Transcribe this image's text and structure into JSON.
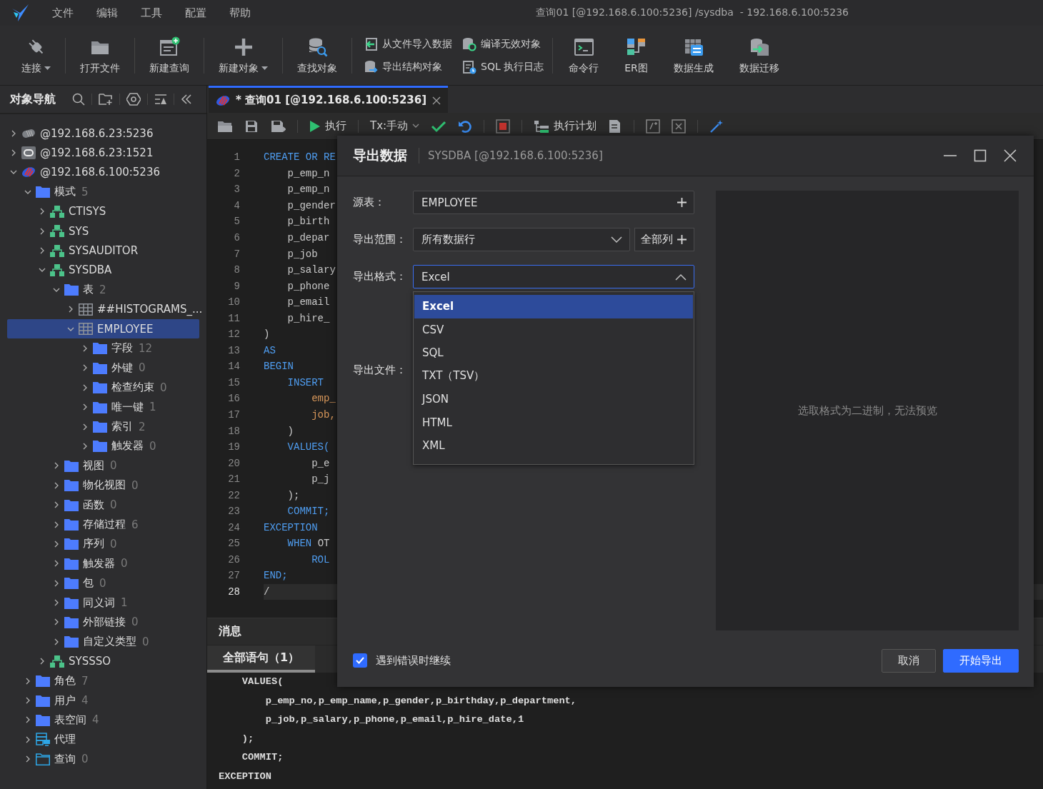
{
  "menu": {
    "items": [
      "文件",
      "编辑",
      "工具",
      "配置",
      "帮助"
    ],
    "title": "查询01 [@192.168.6.100:5236] /sysdba  - 192.168.6.100:5236"
  },
  "toolbar": [
    {
      "kind": "large",
      "label": "连接",
      "dropdown": true
    },
    {
      "kind": "separator"
    },
    {
      "kind": "large",
      "label": "打开文件",
      "dropdown": false
    },
    {
      "kind": "separator"
    },
    {
      "kind": "large",
      "label": "新建查询",
      "dropdown": false
    },
    {
      "kind": "separator"
    },
    {
      "kind": "large",
      "label": "新建对象",
      "dropdown": true
    },
    {
      "kind": "separator"
    },
    {
      "kind": "large",
      "label": "查找对象",
      "dropdown": false
    },
    {
      "kind": "separator"
    },
    {
      "kind": "pairs",
      "columns": [
        [
          "从文件导入数据",
          "导出结构对象"
        ],
        [
          "编译无效对象",
          "SQL 执行日志"
        ]
      ]
    },
    {
      "kind": "separator"
    },
    {
      "kind": "large",
      "label": "命令行",
      "dropdown": false
    },
    {
      "kind": "large",
      "label": "ER图",
      "dropdown": false
    },
    {
      "kind": "large",
      "label": "数据生成",
      "dropdown": false
    },
    {
      "kind": "large",
      "label": "数据迁移",
      "dropdown": false
    }
  ],
  "sidebar": {
    "title": "对象导航",
    "tree": [
      {
        "label": "@192.168.6.23:5236",
        "kind": "server",
        "expanded": false,
        "selected": false
      },
      {
        "label": "@192.168.6.23:1521",
        "kind": "oracle",
        "expanded": false,
        "selected": false
      },
      {
        "label": "@192.168.6.100:5236",
        "kind": "dm",
        "expanded": true,
        "selected": false,
        "children": [
          {
            "label": "模式",
            "count": "5",
            "kind": "folder",
            "expanded": true,
            "selected": false,
            "children": [
              {
                "label": "CTISYS",
                "kind": "schema",
                "expanded": false,
                "selected": false
              },
              {
                "label": "SYS",
                "kind": "schema",
                "expanded": false,
                "selected": false
              },
              {
                "label": "SYSAUDITOR",
                "kind": "schema",
                "expanded": false,
                "selected": false
              },
              {
                "label": "SYSDBA",
                "kind": "schema",
                "expanded": true,
                "selected": false,
                "children": [
                  {
                    "label": "表",
                    "count": "2",
                    "kind": "folder",
                    "expanded": true,
                    "selected": false,
                    "children": [
                      {
                        "label": "##HISTOGRAMS_...",
                        "kind": "table",
                        "expanded": false,
                        "selected": false
                      },
                      {
                        "label": "EMPLOYEE",
                        "kind": "table",
                        "expanded": true,
                        "selected": true,
                        "children": [
                          {
                            "label": "字段",
                            "count": "12",
                            "kind": "folder",
                            "expanded": false,
                            "selected": false
                          },
                          {
                            "label": "外键",
                            "count": "0",
                            "kind": "folder",
                            "expanded": false,
                            "selected": false
                          },
                          {
                            "label": "检查约束",
                            "count": "0",
                            "kind": "folder",
                            "expanded": false,
                            "selected": false
                          },
                          {
                            "label": "唯一键",
                            "count": "1",
                            "kind": "folder",
                            "expanded": false,
                            "selected": false
                          },
                          {
                            "label": "索引",
                            "count": "2",
                            "kind": "folder",
                            "expanded": false,
                            "selected": false
                          },
                          {
                            "label": "触发器",
                            "count": "0",
                            "kind": "folder",
                            "expanded": false,
                            "selected": false
                          }
                        ]
                      }
                    ]
                  },
                  {
                    "label": "视图",
                    "count": "0",
                    "kind": "folder",
                    "expanded": false,
                    "selected": false
                  },
                  {
                    "label": "物化视图",
                    "count": "0",
                    "kind": "folder",
                    "expanded": false,
                    "selected": false
                  },
                  {
                    "label": "函数",
                    "count": "0",
                    "kind": "folder",
                    "expanded": false,
                    "selected": false
                  },
                  {
                    "label": "存储过程",
                    "count": "6",
                    "kind": "folder",
                    "expanded": false,
                    "selected": false
                  },
                  {
                    "label": "序列",
                    "count": "0",
                    "kind": "folder",
                    "expanded": false,
                    "selected": false
                  },
                  {
                    "label": "触发器",
                    "count": "0",
                    "kind": "folder",
                    "expanded": false,
                    "selected": false
                  },
                  {
                    "label": "包",
                    "count": "0",
                    "kind": "folder",
                    "expanded": false,
                    "selected": false
                  },
                  {
                    "label": "同义词",
                    "count": "1",
                    "kind": "folder",
                    "expanded": false,
                    "selected": false
                  },
                  {
                    "label": "外部链接",
                    "count": "0",
                    "kind": "folder",
                    "expanded": false,
                    "selected": false
                  },
                  {
                    "label": "自定义类型",
                    "count": "0",
                    "kind": "folder",
                    "expanded": false,
                    "selected": false
                  }
                ]
              },
              {
                "label": "SYSSSO",
                "kind": "schema",
                "expanded": false,
                "selected": false
              }
            ]
          },
          {
            "label": "角色",
            "count": "7",
            "kind": "folder",
            "expanded": false,
            "selected": false
          },
          {
            "label": "用户",
            "count": "4",
            "kind": "folder",
            "expanded": false,
            "selected": false
          },
          {
            "label": "表空间",
            "count": "4",
            "kind": "folder",
            "expanded": false,
            "selected": false
          },
          {
            "label": "代理",
            "kind": "agent",
            "expanded": false,
            "selected": false
          },
          {
            "label": "查询",
            "count": "0",
            "kind": "query",
            "expanded": false,
            "selected": false
          }
        ]
      }
    ]
  },
  "editor": {
    "tab": {
      "label": "* 查询01 [@192.168.6.100:5236]",
      "selected": true
    },
    "run_label": "执行",
    "tx_label": "Tx:手动",
    "plan_label": "执行计划",
    "lines": [
      {
        "number": "1",
        "current": false,
        "segments": [
          {
            "text": "CREATE OR RE",
            "kind": "keyword"
          }
        ]
      },
      {
        "number": "2",
        "current": false,
        "segments": [
          {
            "text": "    p_emp_n",
            "kind": "plain"
          }
        ]
      },
      {
        "number": "3",
        "current": false,
        "segments": [
          {
            "text": "    p_emp_n",
            "kind": "plain"
          }
        ]
      },
      {
        "number": "4",
        "current": false,
        "segments": [
          {
            "text": "    p_gender",
            "kind": "plain"
          }
        ]
      },
      {
        "number": "5",
        "current": false,
        "segments": [
          {
            "text": "    p_birth",
            "kind": "plain"
          }
        ]
      },
      {
        "number": "6",
        "current": false,
        "segments": [
          {
            "text": "    p_depar",
            "kind": "plain"
          }
        ]
      },
      {
        "number": "7",
        "current": false,
        "segments": [
          {
            "text": "    p_job",
            "kind": "plain"
          }
        ]
      },
      {
        "number": "8",
        "current": false,
        "segments": [
          {
            "text": "    p_salary",
            "kind": "plain"
          }
        ]
      },
      {
        "number": "9",
        "current": false,
        "segments": [
          {
            "text": "    p_phone",
            "kind": "plain"
          }
        ]
      },
      {
        "number": "10",
        "current": false,
        "segments": [
          {
            "text": "    p_email",
            "kind": "plain"
          }
        ]
      },
      {
        "number": "11",
        "current": false,
        "segments": [
          {
            "text": "    p_hire_",
            "kind": "plain"
          }
        ]
      },
      {
        "number": "12",
        "current": false,
        "segments": [
          {
            "text": ")",
            "kind": "plain"
          }
        ]
      },
      {
        "number": "13",
        "current": false,
        "segments": [
          {
            "text": "AS",
            "kind": "keyword"
          }
        ]
      },
      {
        "number": "14",
        "current": false,
        "segments": [
          {
            "text": "BEGIN",
            "kind": "keyword"
          }
        ]
      },
      {
        "number": "15",
        "current": false,
        "segments": [
          {
            "text": "    INSERT",
            "kind": "keyword"
          }
        ]
      },
      {
        "number": "16",
        "current": false,
        "segments": [
          {
            "text": "        emp_",
            "kind": "column"
          }
        ]
      },
      {
        "number": "17",
        "current": false,
        "segments": [
          {
            "text": "        job,",
            "kind": "column"
          }
        ]
      },
      {
        "number": "18",
        "current": false,
        "segments": [
          {
            "text": "    )",
            "kind": "plain"
          }
        ]
      },
      {
        "number": "19",
        "current": false,
        "segments": [
          {
            "text": "    VALUES(",
            "kind": "keyword"
          }
        ]
      },
      {
        "number": "20",
        "current": false,
        "segments": [
          {
            "text": "        p_e",
            "kind": "plain"
          }
        ]
      },
      {
        "number": "21",
        "current": false,
        "segments": [
          {
            "text": "        p_j",
            "kind": "plain"
          }
        ]
      },
      {
        "number": "22",
        "current": false,
        "segments": [
          {
            "text": "    );",
            "kind": "plain"
          }
        ]
      },
      {
        "number": "23",
        "current": false,
        "segments": [
          {
            "text": "    COMMIT;",
            "kind": "keyword"
          }
        ]
      },
      {
        "number": "24",
        "current": false,
        "segments": [
          {
            "text": "EXCEPTION",
            "kind": "keyword"
          }
        ]
      },
      {
        "number": "25",
        "current": false,
        "segments": [
          {
            "text": "    WHEN ",
            "kind": "keyword"
          },
          {
            "text": "OT",
            "kind": "plain"
          }
        ]
      },
      {
        "number": "26",
        "current": false,
        "segments": [
          {
            "text": "        ROL",
            "kind": "keyword"
          }
        ]
      },
      {
        "number": "27",
        "current": false,
        "segments": [
          {
            "text": "END;",
            "kind": "keyword"
          }
        ]
      },
      {
        "number": "28",
        "current": true,
        "segments": [
          {
            "text": "/",
            "kind": "plain"
          }
        ]
      }
    ]
  },
  "messages": {
    "title": "消息",
    "tabs": [
      {
        "label": "全部语句（1）",
        "selected": true
      }
    ],
    "lines": [
      "    VALUES(",
      "        p_emp_no,p_emp_name,p_gender,p_birthday,p_department,",
      "        p_job,p_salary,p_phone,p_email,p_hire_date,1",
      "    );",
      "    COMMIT;",
      "EXCEPTION"
    ]
  },
  "dialog": {
    "title": "导出数据",
    "subtitle": "SYSDBA [@192.168.6.100:5236]",
    "fields": [
      {
        "kind": "text",
        "label": "源表：",
        "value": "EMPLOYEE"
      },
      {
        "kind": "select",
        "label": "导出范围：",
        "value": "所有数据行",
        "button": "全部列",
        "open": false
      },
      {
        "kind": "select",
        "label": "导出格式：",
        "value": "Excel",
        "open": true
      },
      {
        "kind": "file",
        "label": "导出文件："
      }
    ],
    "options": [
      {
        "label": "Excel",
        "selected": true
      },
      {
        "label": "CSV",
        "selected": false
      },
      {
        "label": "SQL",
        "selected": false
      },
      {
        "label": "TXT（TSV）",
        "selected": false
      },
      {
        "label": "JSON",
        "selected": false
      },
      {
        "label": "HTML",
        "selected": false
      },
      {
        "label": "XML",
        "selected": false
      }
    ],
    "preview": "选取格式为二进制，无法预览",
    "checkbox": {
      "label": "遇到错误时继续",
      "checked": true
    },
    "buttons": [
      {
        "label": "取消",
        "kind": "secondary"
      },
      {
        "label": "开始导出",
        "kind": "primary"
      }
    ]
  }
}
